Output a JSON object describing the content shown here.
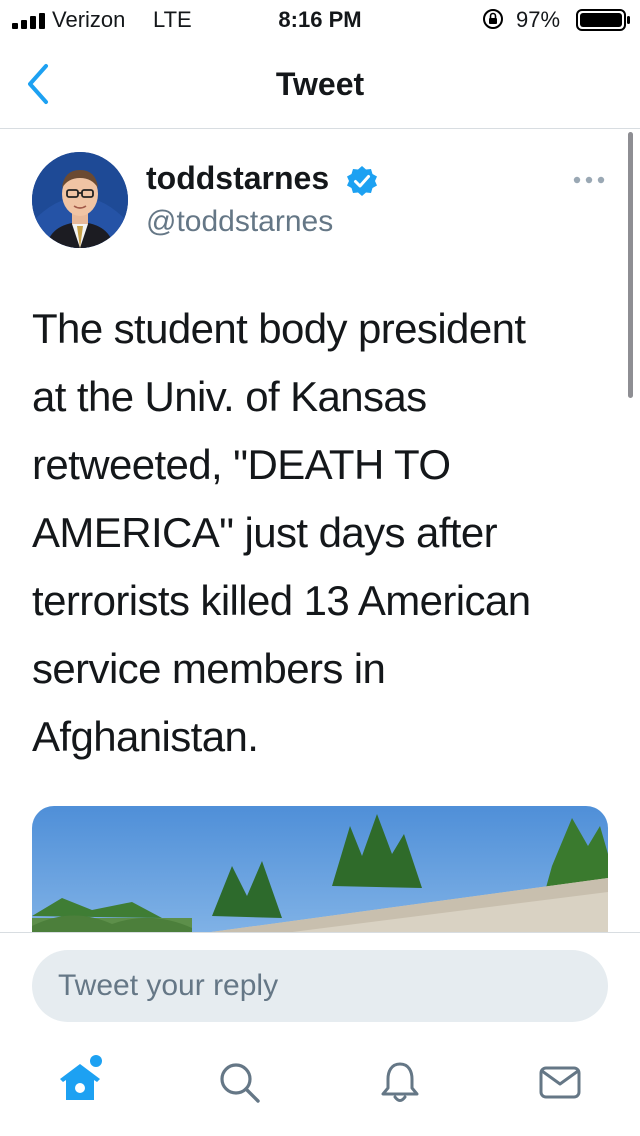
{
  "status_bar": {
    "carrier": "Verizon",
    "network": "LTE",
    "time": "8:16 PM",
    "battery_percent": "97%",
    "icons": [
      "signal-icon",
      "rotation-lock-icon",
      "battery-icon"
    ]
  },
  "nav": {
    "title": "Tweet",
    "back_icon": "chevron-left-icon"
  },
  "tweet": {
    "display_name": "toddstarnes",
    "handle": "@toddstarnes",
    "verified": true,
    "text": "The student body president\nat the Univ. of Kansas\nretweeted, \"DEATH TO\nAMERICA\" just days after\nterrorists killed 13 American\nservice members in\nAfghanistan."
  },
  "reply": {
    "placeholder": "Tweet your reply"
  },
  "tabs": [
    {
      "name": "home",
      "icon": "home-icon",
      "active": true
    },
    {
      "name": "search",
      "icon": "search-icon",
      "active": false
    },
    {
      "name": "notifications",
      "icon": "bell-icon",
      "active": false
    },
    {
      "name": "messages",
      "icon": "mail-icon",
      "active": false
    }
  ],
  "colors": {
    "accent": "#1da1f2",
    "text": "#14171a",
    "secondary_text": "#657786",
    "reply_bg": "#e6ecf0"
  }
}
